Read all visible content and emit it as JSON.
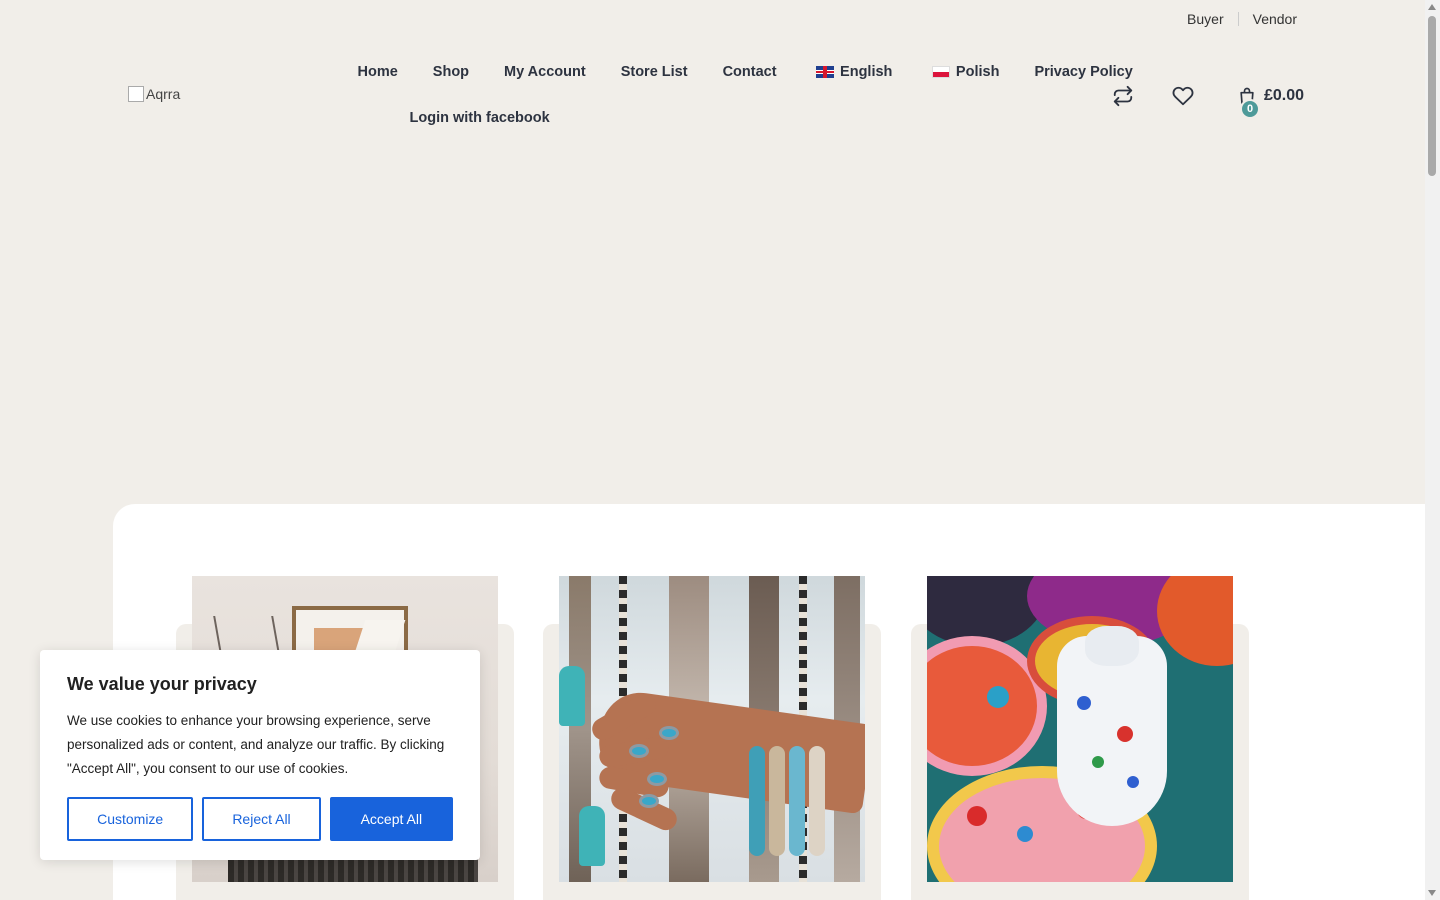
{
  "topbar": {
    "buyer": "Buyer",
    "vendor": "Vendor"
  },
  "logo": {
    "alt": "Aqrra"
  },
  "nav": {
    "home": "Home",
    "shop": "Shop",
    "my_account": "My Account",
    "store_list": "Store List",
    "contact": "Contact",
    "english": "English",
    "polish": "Polish",
    "privacy_policy": "Privacy Policy",
    "login_facebook": "Login with facebook"
  },
  "header": {
    "cart_count": "0",
    "cart_total": "£0.00"
  },
  "consent": {
    "title": "We value your privacy",
    "body": "We use cookies to enhance your browsing experience, serve personalized ads or content, and analyze our traffic. By clicking \"Accept All\", you consent to our use of cookies.",
    "customize": "Customize",
    "reject_all": "Reject All",
    "accept_all": "Accept All"
  },
  "colors": {
    "accent": "#1863dc",
    "badge": "#4e9a99",
    "background": "#f1eee9"
  }
}
